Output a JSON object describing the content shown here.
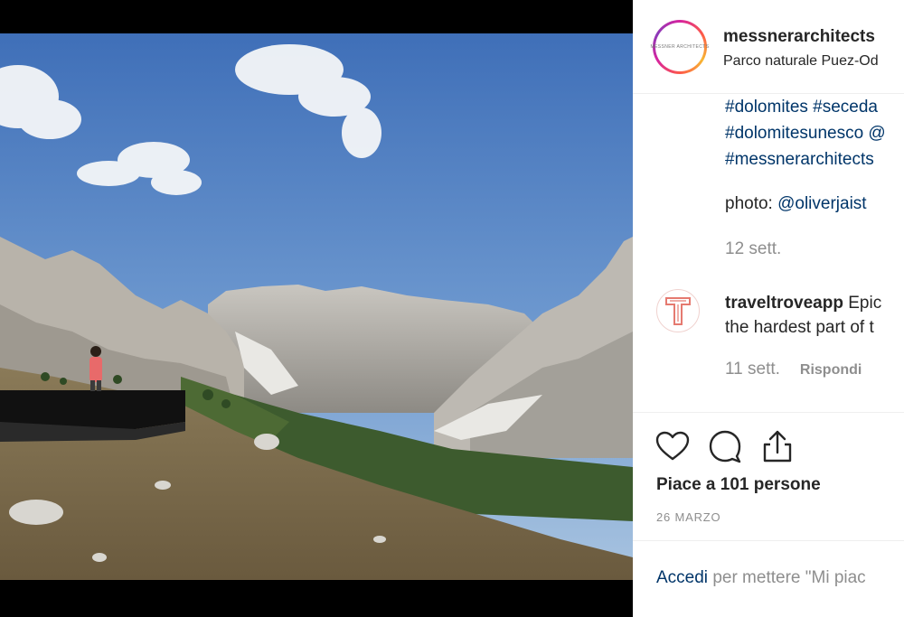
{
  "post": {
    "username": "messnerarchitects",
    "location": "Parco naturale Puez-Od",
    "avatar_logo": "MESSNER ARCHITECTS"
  },
  "caption": {
    "hashtag_lines": [
      "#dolomites #seceda",
      "#dolomitesunesco @",
      "#messnerarchitects"
    ],
    "photo_label": "photo:",
    "photo_mention": "@oliverjaist",
    "time": "12 sett."
  },
  "comment": {
    "avatar_letter": "T",
    "username": "traveltroveapp",
    "text_line1": "Epic",
    "text_line2": "the hardest part of t",
    "time": "11 sett.",
    "reply_label": "Rispondi"
  },
  "actions": {
    "like_icon": "heart-icon",
    "comment_icon": "comment-bubble-icon",
    "share_icon": "share-icon"
  },
  "likes_text": "Piace a 101 persone",
  "date_text": "26 MARZO",
  "login": {
    "link": "Accedi",
    "rest": "per mettere \"Mi piac"
  },
  "colors": {
    "link": "#003569",
    "muted": "#8e8e8e",
    "text": "#262626",
    "jacket": "#e86a6a"
  }
}
